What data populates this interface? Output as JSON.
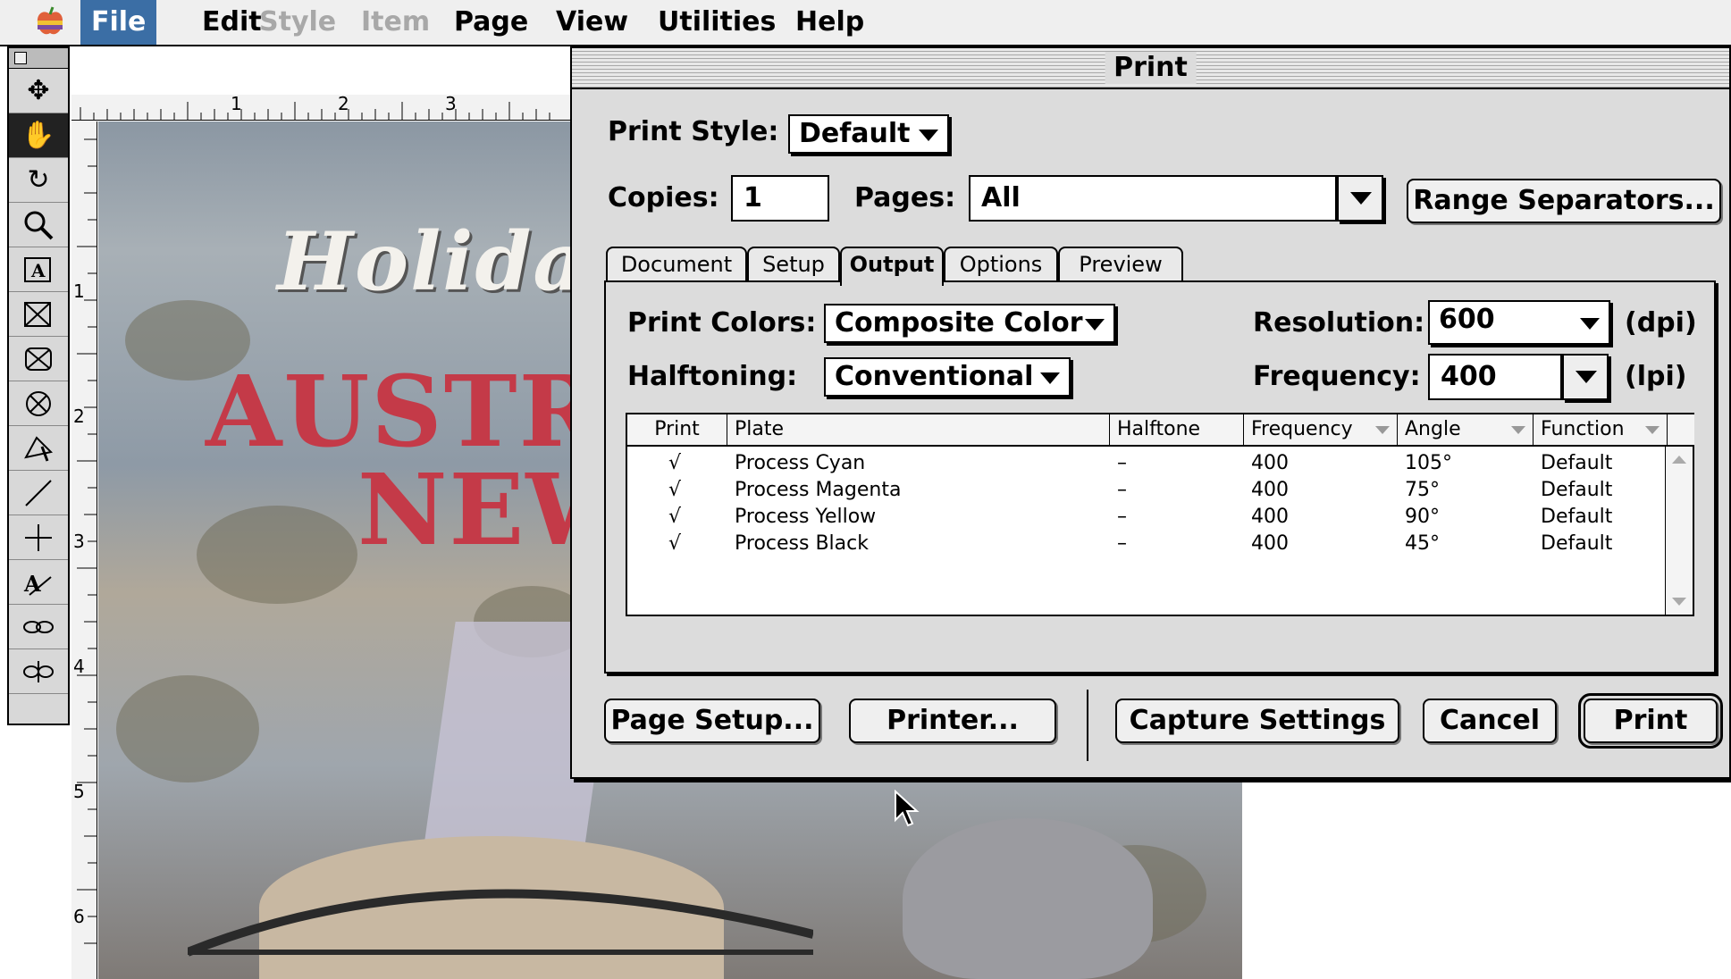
{
  "menubar": {
    "apple_icon": "apple-icon",
    "items": [
      {
        "label": "File",
        "state": "active"
      },
      {
        "label": "Edit",
        "state": "enabled"
      },
      {
        "label": "Style",
        "state": "disabled"
      },
      {
        "label": "Item",
        "state": "disabled"
      },
      {
        "label": "Page",
        "state": "enabled"
      },
      {
        "label": "View",
        "state": "enabled"
      },
      {
        "label": "Utilities",
        "state": "enabled"
      },
      {
        "label": "Help",
        "state": "enabled"
      }
    ]
  },
  "document": {
    "ruler_top_marks": [
      "1",
      "2",
      "3"
    ],
    "ruler_left_marks": [
      "1",
      "2",
      "3",
      "4",
      "5",
      "6"
    ],
    "poster_lines": [
      "Holida",
      "AUSTR",
      "NEW"
    ],
    "tools": [
      "move-icon",
      "hand-icon",
      "rotate-icon",
      "zoom-icon",
      "text-box-icon",
      "picture-box-icon",
      "rect-picture-icon",
      "oval-picture-icon",
      "bezier-picture-icon",
      "line-icon",
      "orthogonal-line-icon",
      "text-path-icon",
      "link-icon",
      "unlink-icon"
    ]
  },
  "dialog": {
    "title": "Print",
    "print_style_label": "Print Style:",
    "print_style_value": "Default",
    "copies_label": "Copies:",
    "copies_value": "1",
    "pages_label": "Pages:",
    "pages_value": "All",
    "range_separators_button": "Range Separators...",
    "tabs": [
      {
        "label": "Document",
        "active": false
      },
      {
        "label": "Setup",
        "active": false
      },
      {
        "label": "Output",
        "active": true
      },
      {
        "label": "Options",
        "active": false
      },
      {
        "label": "Preview",
        "active": false
      }
    ],
    "output": {
      "print_colors_label": "Print Colors:",
      "print_colors_value": "Composite Color",
      "halftoning_label": "Halftoning:",
      "halftoning_value": "Conventional",
      "resolution_label": "Resolution:",
      "resolution_value": "600",
      "resolution_unit": "(dpi)",
      "frequency_label": "Frequency:",
      "frequency_value": "400",
      "frequency_unit": "(lpi)",
      "table": {
        "columns": [
          "Print",
          "Plate",
          "Halftone",
          "Frequency",
          "Angle",
          "Function"
        ],
        "rows": [
          {
            "print": "√",
            "plate": "Process Cyan",
            "halftone": "–",
            "frequency": "400",
            "angle": "105°",
            "function": "Default"
          },
          {
            "print": "√",
            "plate": "Process Magenta",
            "halftone": "–",
            "frequency": "400",
            "angle": "75°",
            "function": "Default"
          },
          {
            "print": "√",
            "plate": "Process Yellow",
            "halftone": "–",
            "frequency": "400",
            "angle": "90°",
            "function": "Default"
          },
          {
            "print": "√",
            "plate": "Process Black",
            "halftone": "–",
            "frequency": "400",
            "angle": "45°",
            "function": "Default"
          }
        ]
      }
    },
    "buttons": {
      "page_setup": "Page Setup...",
      "printer": "Printer...",
      "capture_settings": "Capture Settings",
      "cancel": "Cancel",
      "print": "Print"
    }
  },
  "colors": {
    "menu_highlight": "#3b6ea5",
    "dialog_bg": "#dcdcdc",
    "poster_red": "#c43a48"
  }
}
